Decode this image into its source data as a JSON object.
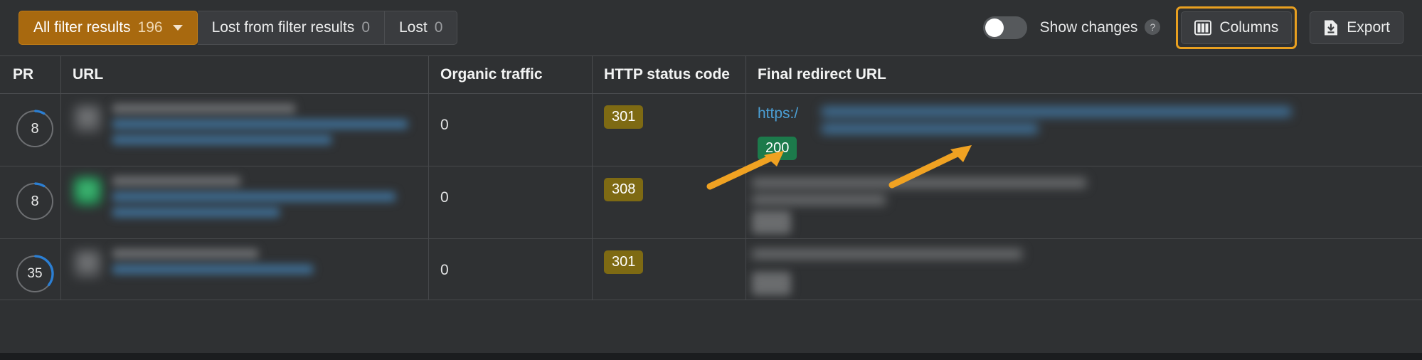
{
  "toolbar": {
    "filters": [
      {
        "label": "All filter results",
        "count": "196",
        "active": true,
        "has_caret": true
      },
      {
        "label": "Lost from filter results",
        "count": "0",
        "active": false,
        "has_caret": false
      },
      {
        "label": "Lost",
        "count": "0",
        "active": false,
        "has_caret": false
      }
    ],
    "toggle": {
      "label": "Show changes",
      "state": "off",
      "help_glyph": "?"
    },
    "columns_button": {
      "label": "Columns",
      "icon": "columns-icon",
      "focused": true
    },
    "export_button": {
      "label": "Export",
      "icon": "download-icon"
    },
    "accent_color": "#e9a020",
    "active_filter_color": "#a8690f"
  },
  "table": {
    "columns": [
      "PR",
      "URL",
      "Organic traffic",
      "HTTP status code",
      "Final redirect URL"
    ],
    "rows": [
      {
        "pr": "8",
        "pr_percent": 8,
        "favicon": "grey",
        "organic_traffic": "0",
        "http_status": "301",
        "http_status_color": "#7e6a13",
        "final_redirect_prefix": "https:/",
        "final_redirect_status": "200",
        "final_redirect_status_color": "#1c7a4b"
      },
      {
        "pr": "8",
        "pr_percent": 8,
        "favicon": "green",
        "organic_traffic": "0",
        "http_status": "308",
        "http_status_color": "#7e6a13",
        "final_redirect_prefix": "",
        "final_redirect_status": "",
        "final_redirect_status_color": "#6a6c6e"
      },
      {
        "pr": "35",
        "pr_percent": 35,
        "favicon": "grey",
        "organic_traffic": "0",
        "http_status": "301",
        "http_status_color": "#7e6a13",
        "final_redirect_prefix": "",
        "final_redirect_status": "",
        "final_redirect_status_color": "#6a6c6e"
      }
    ]
  },
  "annotations": {
    "arrow_color": "#f0a222",
    "arrow_count": 2
  }
}
